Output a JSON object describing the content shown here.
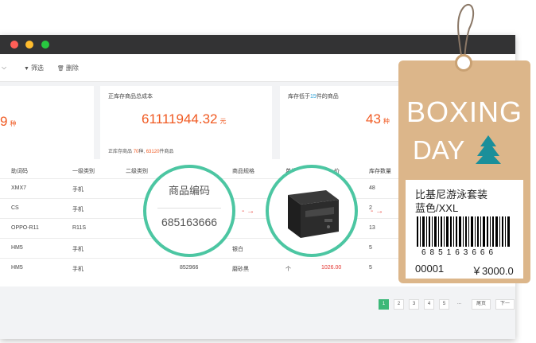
{
  "toolbar": {
    "filter_label": "筛选",
    "delete_label": "删除",
    "filter_icon": "filter-icon",
    "delete_icon": "trash-icon"
  },
  "cards": {
    "card1": {
      "value": "9",
      "unit": "种"
    },
    "card2": {
      "title": "正库存商品总成本",
      "value": "61111944.32",
      "unit": "元",
      "sub_prefix": "正库存商品",
      "sub_count": "70",
      "sub_mid": "种, ",
      "sub_qty": "63120",
      "sub_suffix": "件商品"
    },
    "card3": {
      "title_prefix": "库存低于",
      "title_num": "15",
      "title_suffix": "件的商品",
      "value": "43",
      "unit": "种"
    }
  },
  "table": {
    "headers": [
      "助词码",
      "一级类别",
      "二级类别",
      "商品规格",
      "单位",
      "价",
      "库存数量"
    ],
    "rows": [
      [
        "XMX7",
        "手机",
        "",
        "",
        "",
        "",
        "48"
      ],
      [
        "CS",
        "手机",
        "",
        "",
        "",
        "",
        "2"
      ],
      [
        "OPPO-R11",
        "R11S",
        "",
        "",
        "",
        "",
        "13"
      ],
      [
        "HM5",
        "手机",
        "",
        "银白",
        "",
        "",
        "5"
      ],
      [
        "HM5",
        "手机",
        "852966",
        "磨砂黑",
        "个",
        "1026.00",
        "5"
      ]
    ]
  },
  "pager": {
    "pages": [
      "1",
      "2",
      "3",
      "4",
      "5",
      "..."
    ],
    "prev": "尾页",
    "next": "下一"
  },
  "circle1": {
    "title": "商品编码",
    "code": "685163666"
  },
  "tag": {
    "line1": "BOXING",
    "line2": "DAY",
    "name": "比基尼游泳套装",
    "color": "蓝色/XXL",
    "barcode_digits": "685163666",
    "code": "00001",
    "price": "￥3000.0"
  },
  "colors": {
    "accent_orange": "#f05a22",
    "accent_green": "#3cb878",
    "circle_teal": "#4cc6a2",
    "tag_tan": "#dcb68a",
    "tree_teal": "#1a8f9a"
  }
}
